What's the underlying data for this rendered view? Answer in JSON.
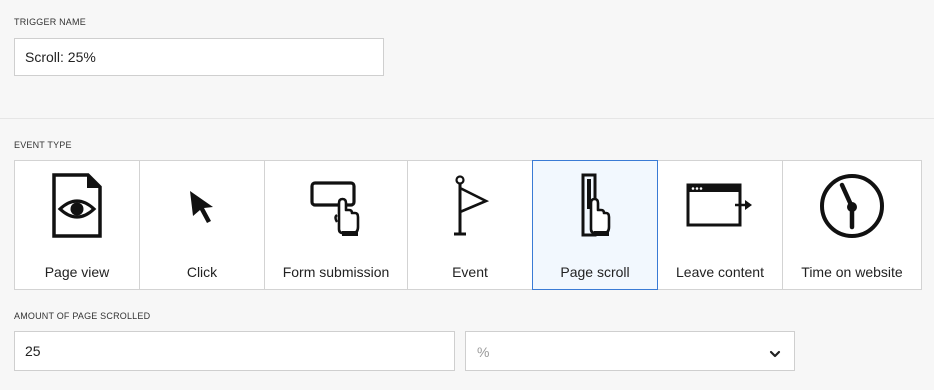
{
  "trigger_name": {
    "label": "TRIGGER NAME",
    "value": "Scroll: 25%"
  },
  "event_type": {
    "label": "EVENT TYPE",
    "selected": "page-scroll",
    "options": [
      {
        "id": "page-view",
        "label": "Page view",
        "icon": "page-view-icon"
      },
      {
        "id": "click",
        "label": "Click",
        "icon": "cursor-icon"
      },
      {
        "id": "form-submission",
        "label": "Form submission",
        "icon": "form-submission-icon"
      },
      {
        "id": "event",
        "label": "Event",
        "icon": "flag-icon"
      },
      {
        "id": "page-scroll",
        "label": "Page scroll",
        "icon": "page-scroll-icon"
      },
      {
        "id": "leave-content",
        "label": "Leave content",
        "icon": "leave-content-icon"
      },
      {
        "id": "time-on-website",
        "label": "Time on website",
        "icon": "clock-icon"
      }
    ]
  },
  "amount_scrolled": {
    "label": "AMOUNT OF PAGE SCROLLED",
    "value": "25",
    "unit_selected": "%"
  },
  "colors": {
    "selected_border": "#3a7bd5",
    "selected_bg": "#f2f8fe"
  }
}
